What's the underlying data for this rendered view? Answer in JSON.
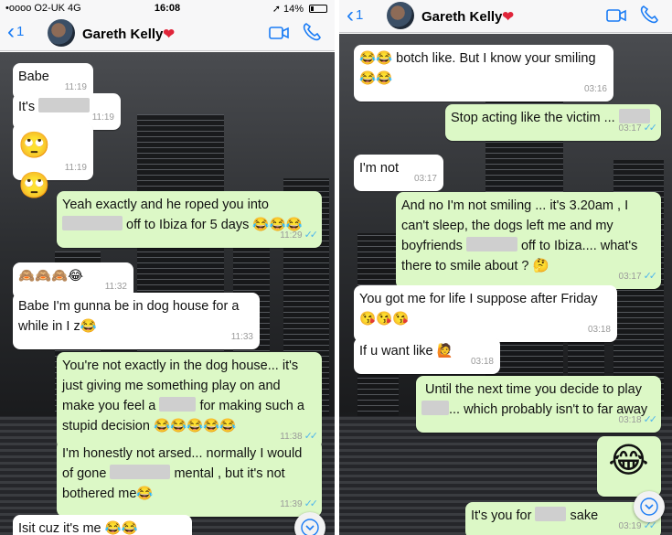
{
  "left": {
    "status": {
      "carrier": "•oooo O2-UK  4G",
      "time": "16:08",
      "battery": "➚ 14%"
    },
    "header": {
      "back_label": "1",
      "contact": "Gareth Kelly",
      "heart": "❤"
    },
    "messages": [
      {
        "text": "Babe",
        "time": "11:19"
      },
      {
        "text": "It's",
        "time": "11:19"
      },
      {
        "text": "🙄 🙄",
        "time": "11:19"
      },
      {
        "text_a": "Yeah exactly and he roped you into",
        "text_b": "off to Ibiza for 5 days 😂😂😂",
        "time": "11:29"
      },
      {
        "text": "🙈🙈🙈😂",
        "time": "11:32"
      },
      {
        "text": "Babe I'm gunna be in dog house for a while in I z😂",
        "time": "11:33"
      },
      {
        "text_a": "You're not exactly in the dog house... it's just giving me something play on and make you feel a",
        "text_b": "for making such a stupid decision 😂😂😂😂😂",
        "time": "11:38"
      },
      {
        "text_a": "I'm honestly not arsed... normally I would of gone",
        "text_b": "mental , but it's not bothered me😂",
        "time": "11:39"
      },
      {
        "text": "Isit cuz it's me 😂😂",
        "time": ""
      }
    ]
  },
  "right": {
    "header": {
      "back_label": "1",
      "contact": "Gareth Kelly",
      "heart": "❤"
    },
    "messages": [
      {
        "text": "😂😂 botch like. But I know your smiling 😂😂",
        "time": "03:16"
      },
      {
        "text": "Stop acting like the victim ...",
        "time": "03:17"
      },
      {
        "text": "I'm not",
        "time": "03:17"
      },
      {
        "text_a": "And no I'm not smiling ... it's 3.20am , I can't sleep, the dogs left me and my boyfriends",
        "text_b": "off to Ibiza.... what's there to smile about ? 🤔",
        "time": "03:17"
      },
      {
        "text": "You got me for life I suppose after Friday 😘😘😘",
        "time": "03:18"
      },
      {
        "text": "If u want like 🙋",
        "time": "03:18"
      },
      {
        "text_a": "Until the next time you decide to play",
        "text_b": "... which probably isn't to far away",
        "time": "03:18"
      },
      {
        "text": "😂",
        "time": "03:19"
      },
      {
        "text_a": "It's you for",
        "text_b": "sake",
        "time": "03:19"
      }
    ]
  },
  "colors": {
    "incoming": "#ffffff",
    "outgoing": "#dcf8c6",
    "accent": "#1a7cf5",
    "read_tick": "#4fb6ec"
  },
  "icons": {
    "back": "chevron-left-icon",
    "video": "video-camera-icon",
    "call": "phone-icon",
    "scroll": "chevron-down-icon",
    "read": "double-check-icon"
  }
}
